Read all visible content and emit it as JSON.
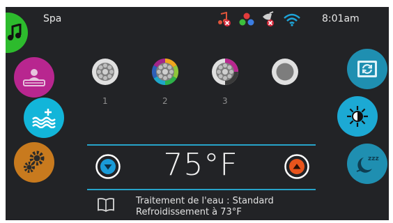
{
  "status_bar": {
    "title": "Spa",
    "time": "8:01am",
    "icons": [
      "music-muted-icon",
      "color-dots-icon",
      "gardening-muted-icon",
      "wifi-icon"
    ]
  },
  "left_buttons": [
    {
      "icon": "music-icon",
      "color": "#2dbb2d"
    },
    {
      "icon": "spa-light-icon",
      "color": "#b8268f"
    },
    {
      "icon": "water-temperature-plus-icon",
      "color": "#12b5d9"
    },
    {
      "icon": "settings-gears-icon",
      "color": "#c87a1e"
    }
  ],
  "right_buttons": [
    {
      "icon": "screen-rotate-icon",
      "color": "#1f8fb1"
    },
    {
      "icon": "brightness-icon",
      "color": "#1ca9d4"
    },
    {
      "icon": "sleep-moon-icon",
      "color": "#1f8fb1"
    }
  ],
  "pumps": [
    {
      "label": "1",
      "state": "off"
    },
    {
      "label": "2",
      "state": "on-colors"
    },
    {
      "label": "3",
      "state": "on-partial"
    },
    {
      "label": "",
      "state": "ring"
    }
  ],
  "temperature": {
    "value": "75°F",
    "down_color": "#1a9bd8",
    "up_color": "#e8541c",
    "line_color": "#27a3c9"
  },
  "info": {
    "line1": "Traitement de l'eau : Standard",
    "line2": "Refroidissement à 73°F"
  }
}
